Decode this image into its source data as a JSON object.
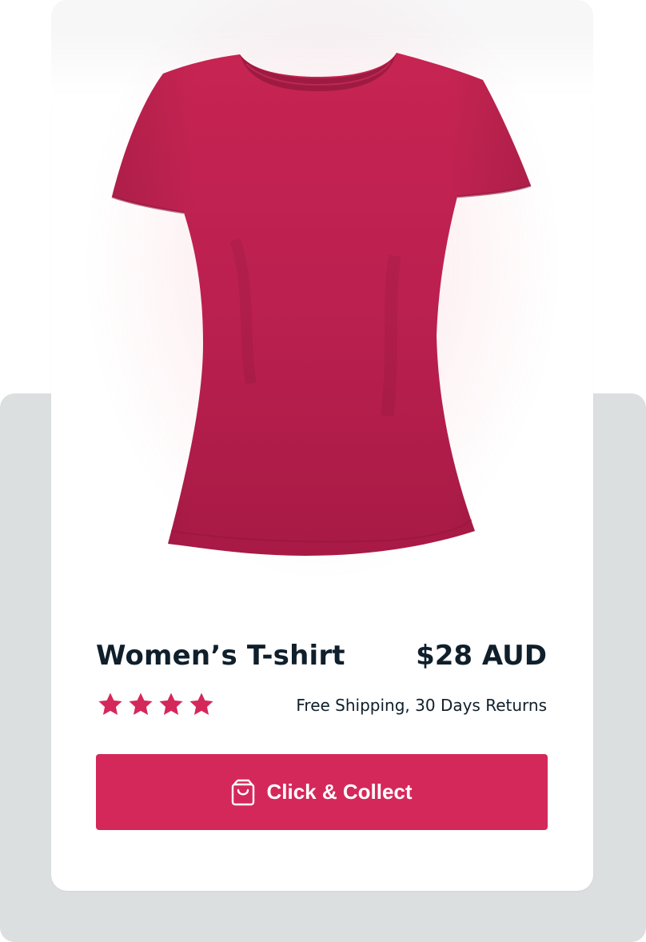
{
  "product": {
    "title": "Women’s T-shirt",
    "price": "$28 AUD",
    "rating": 4,
    "rating_max": 4,
    "shipping_note": "Free Shipping, 30 Days Returns",
    "image_icon": "tshirt-photo"
  },
  "cta": {
    "label": "Click & Collect",
    "icon": "shopping-bag-icon"
  },
  "colors": {
    "accent": "#d4285b",
    "tshirt": "#c0234f",
    "text": "#0f1f2b",
    "backdrop": "#dcdfe0"
  }
}
